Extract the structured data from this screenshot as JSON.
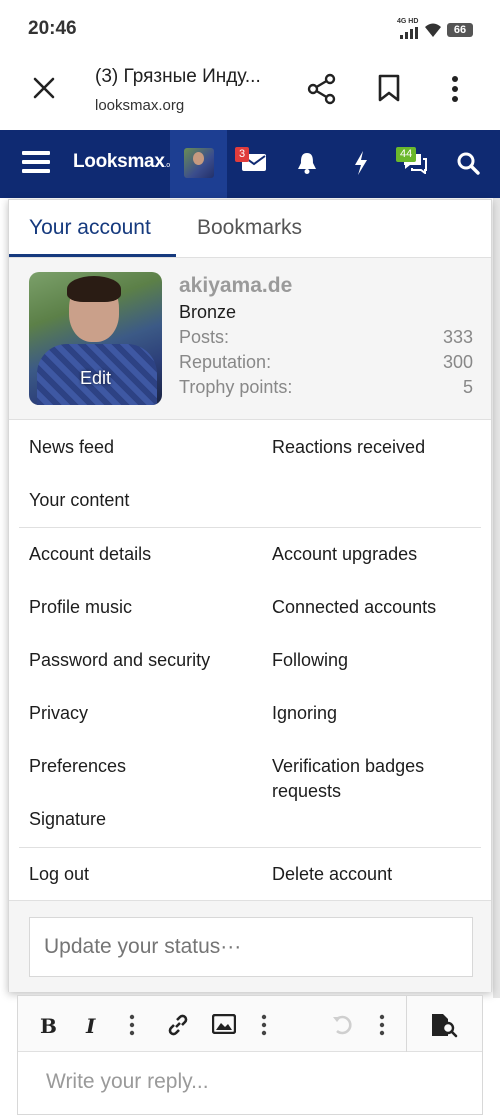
{
  "status_bar": {
    "time": "20:46",
    "network": "4G HD",
    "battery": "66"
  },
  "browser": {
    "title": "(3) Грязные Инду...",
    "url": "looksmax.org",
    "icons": [
      "close-icon",
      "share-icon",
      "bookmark-icon",
      "more-vert-icon"
    ]
  },
  "site_nav": {
    "logo_main": "Looksmax",
    "logo_suffix": ".org",
    "conversations_badge": "3",
    "chat_badge": "44",
    "icons": [
      "menu-icon",
      "avatar",
      "envelope-icon",
      "bell-icon",
      "lightning-icon",
      "chat-icon",
      "search-icon"
    ]
  },
  "account_panel": {
    "tabs": {
      "active": "Your account",
      "inactive": "Bookmarks"
    },
    "profile": {
      "edit_label": "Edit",
      "username": "akiyama.de",
      "rank": "Bronze",
      "stats": [
        {
          "label": "Posts:",
          "value": "333"
        },
        {
          "label": "Reputation:",
          "value": "300"
        },
        {
          "label": "Trophy points:",
          "value": "5"
        }
      ]
    },
    "menu": {
      "news_feed": "News feed",
      "reactions_received": "Reactions received",
      "your_content": "Your content",
      "account_details": "Account details",
      "account_upgrades": "Account upgrades",
      "profile_music": "Profile music",
      "connected_accounts": "Connected accounts",
      "password_security": "Password and security",
      "following": "Following",
      "privacy": "Privacy",
      "ignoring": "Ignoring",
      "preferences": "Preferences",
      "verification_badges_line1": "Verification badges",
      "verification_badges_line2": "requests",
      "signature": "Signature",
      "log_out": "Log out",
      "delete_account": "Delete account"
    },
    "status_placeholder": "Update your status···"
  },
  "editor": {
    "reply_placeholder": "Write your reply...",
    "toolbar_icons": [
      "bold-icon",
      "italic-icon",
      "more-options-icon",
      "link-icon",
      "image-icon",
      "more-options-icon",
      "undo-icon",
      "more-options-icon",
      "preview-icon"
    ]
  }
}
